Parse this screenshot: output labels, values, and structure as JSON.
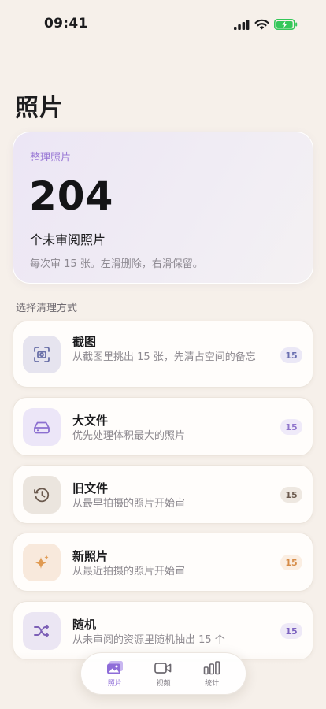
{
  "status_bar": {
    "time": "09:41"
  },
  "page": {
    "title": "照片"
  },
  "hero": {
    "kicker": "整理照片",
    "count": "204",
    "subtitle": "个未审阅照片",
    "hint": "每次审 15 张。左滑删除，右滑保留。"
  },
  "section": {
    "label": "选择清理方式"
  },
  "options": [
    {
      "title": "截图",
      "desc": "从截图里挑出 15 张，先清占空间的备忘",
      "badge": "15",
      "icon": "screenshot-icon",
      "tint": "#e6e4ef",
      "icon_color": "#6a70a8",
      "badge_bg": "#ebe8f6",
      "badge_color": "#6a6fb0"
    },
    {
      "title": "大文件",
      "desc": "优先处理体积最大的照片",
      "badge": "15",
      "icon": "storage-drive-icon",
      "tint": "#ece6f8",
      "icon_color": "#8b6fd0",
      "badge_bg": "#efeaf9",
      "badge_color": "#9076cc"
    },
    {
      "title": "旧文件",
      "desc": "从最早拍摄的照片开始审",
      "badge": "15",
      "icon": "history-clock-icon",
      "tint": "#ebe5de",
      "icon_color": "#6b5a4e",
      "badge_bg": "#eee8e1",
      "badge_color": "#6b5a4e"
    },
    {
      "title": "新照片",
      "desc": "从最近拍摄的照片开始审",
      "badge": "15",
      "icon": "sparkles-icon",
      "tint": "#f8e9dc",
      "icon_color": "#e09a52",
      "badge_bg": "#fbeee2",
      "badge_color": "#d68c48"
    },
    {
      "title": "随机",
      "desc": "从未审阅的资源里随机抽出 15 个",
      "badge": "15",
      "icon": "shuffle-icon",
      "tint": "#ebe6f3",
      "icon_color": "#7c5fb6",
      "badge_bg": "#eee9f7",
      "badge_color": "#7c62bf"
    }
  ],
  "tabs": [
    {
      "label": "照片",
      "icon": "photos-icon",
      "active": true
    },
    {
      "label": "视频",
      "icon": "video-icon",
      "active": false
    },
    {
      "label": "统计",
      "icon": "stats-icon",
      "active": false
    }
  ],
  "colors": {
    "accent": "#8e6cd8",
    "background": "#f6f0ea"
  }
}
